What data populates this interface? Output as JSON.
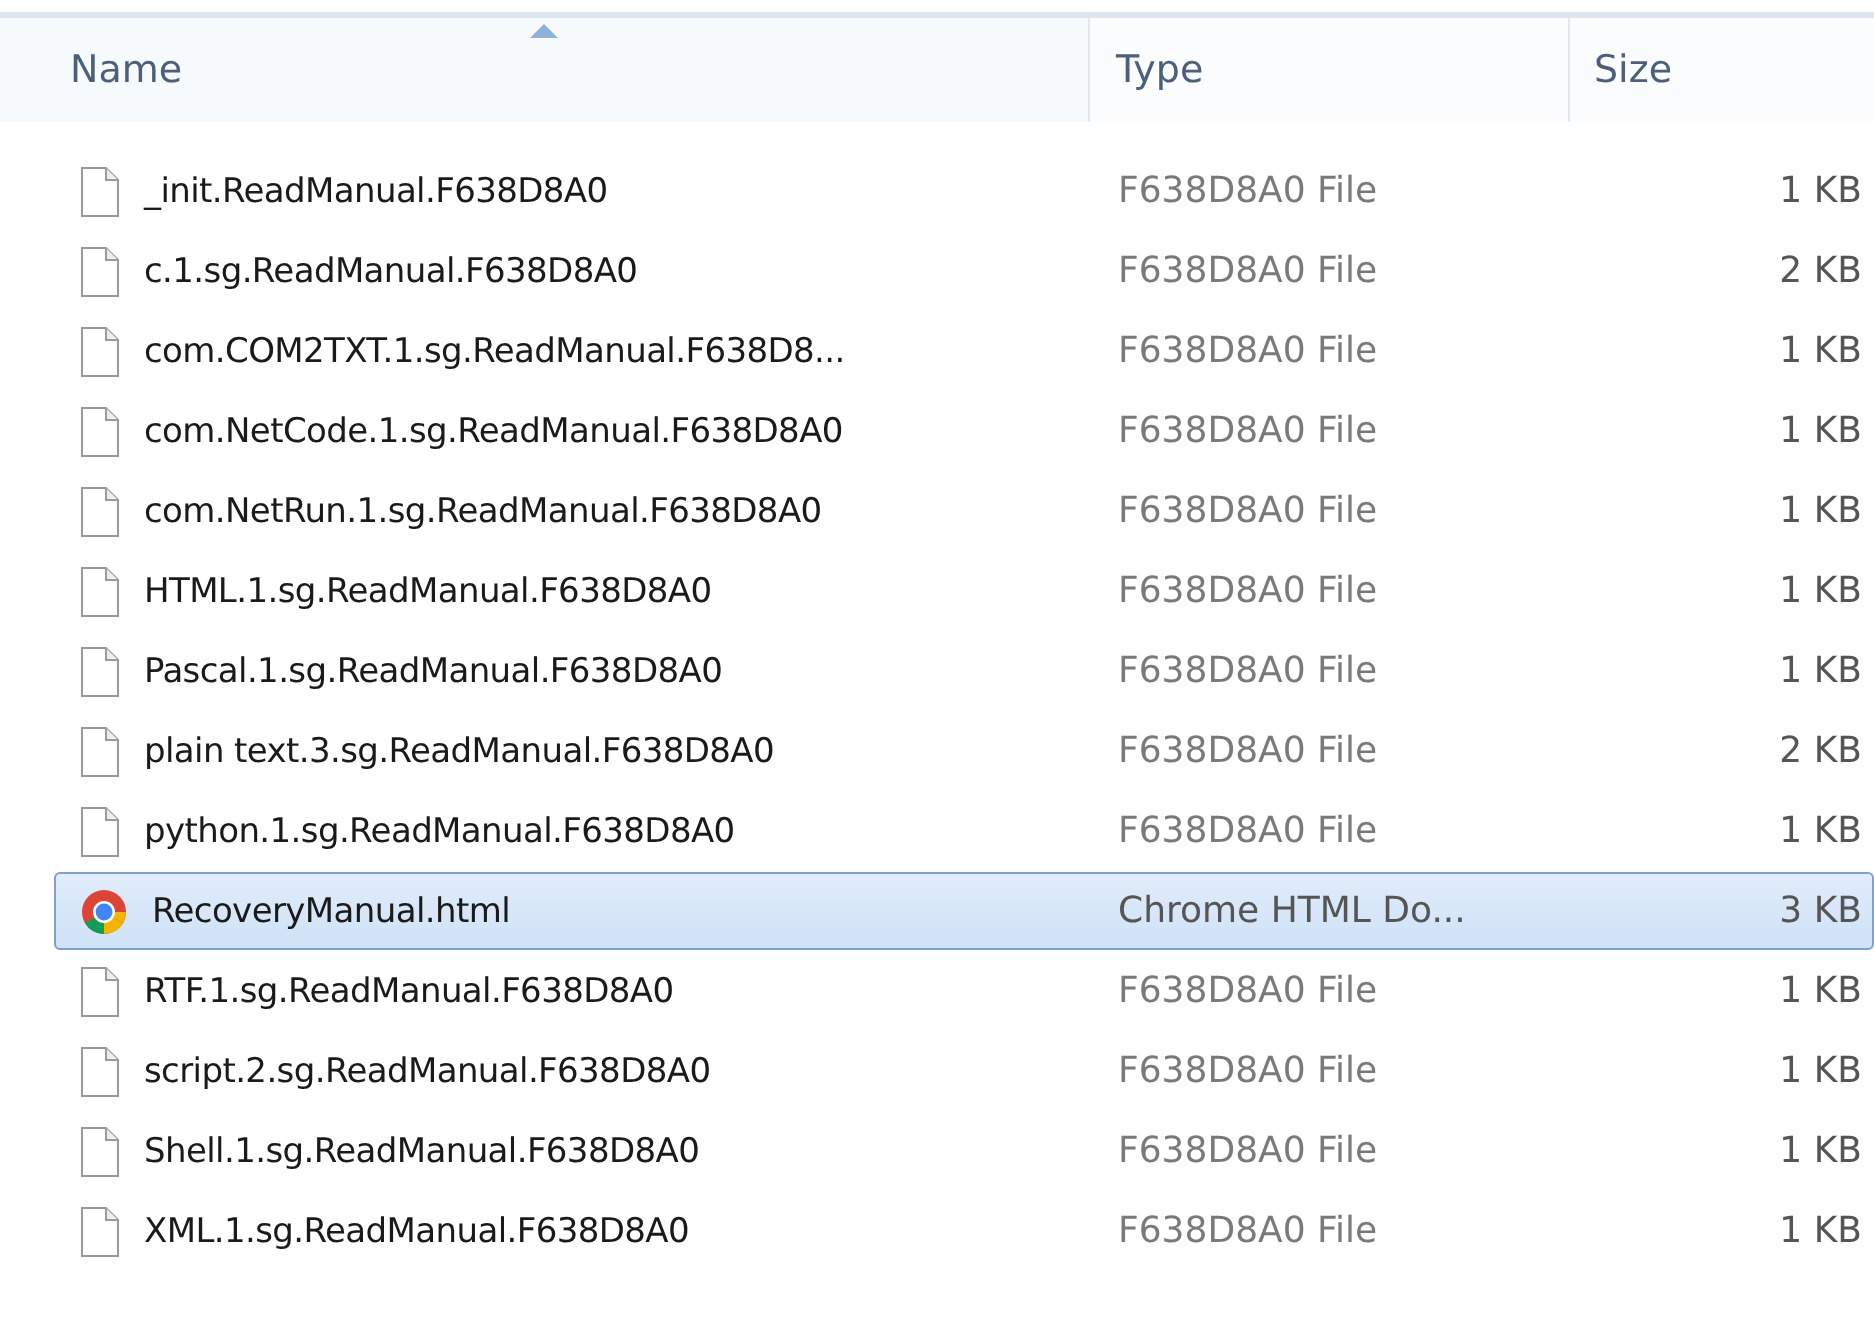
{
  "columns": [
    {
      "label": "Name",
      "sorted": true
    },
    {
      "label": "Type",
      "sorted": false
    },
    {
      "label": "Size",
      "sorted": false
    }
  ],
  "rows": [
    {
      "name": "_init.ReadManual.F638D8A0",
      "type": "F638D8A0 File",
      "size": "1 KB",
      "kind": "file",
      "selected": false
    },
    {
      "name": "c.1.sg.ReadManual.F638D8A0",
      "type": "F638D8A0 File",
      "size": "2 KB",
      "kind": "file",
      "selected": false
    },
    {
      "name": "com.COM2TXT.1.sg.ReadManual.F638D8...",
      "type": "F638D8A0 File",
      "size": "1 KB",
      "kind": "file",
      "selected": false
    },
    {
      "name": "com.NetCode.1.sg.ReadManual.F638D8A0",
      "type": "F638D8A0 File",
      "size": "1 KB",
      "kind": "file",
      "selected": false
    },
    {
      "name": "com.NetRun.1.sg.ReadManual.F638D8A0",
      "type": "F638D8A0 File",
      "size": "1 KB",
      "kind": "file",
      "selected": false
    },
    {
      "name": "HTML.1.sg.ReadManual.F638D8A0",
      "type": "F638D8A0 File",
      "size": "1 KB",
      "kind": "file",
      "selected": false
    },
    {
      "name": "Pascal.1.sg.ReadManual.F638D8A0",
      "type": "F638D8A0 File",
      "size": "1 KB",
      "kind": "file",
      "selected": false
    },
    {
      "name": "plain text.3.sg.ReadManual.F638D8A0",
      "type": "F638D8A0 File",
      "size": "2 KB",
      "kind": "file",
      "selected": false
    },
    {
      "name": "python.1.sg.ReadManual.F638D8A0",
      "type": "F638D8A0 File",
      "size": "1 KB",
      "kind": "file",
      "selected": false
    },
    {
      "name": "RecoveryManual.html",
      "type": "Chrome HTML Do...",
      "size": "3 KB",
      "kind": "browser",
      "selected": true
    },
    {
      "name": "RTF.1.sg.ReadManual.F638D8A0",
      "type": "F638D8A0 File",
      "size": "1 KB",
      "kind": "file",
      "selected": false
    },
    {
      "name": "script.2.sg.ReadManual.F638D8A0",
      "type": "F638D8A0 File",
      "size": "1 KB",
      "kind": "file",
      "selected": false
    },
    {
      "name": "Shell.1.sg.ReadManual.F638D8A0",
      "type": "F638D8A0 File",
      "size": "1 KB",
      "kind": "file",
      "selected": false
    },
    {
      "name": "XML.1.sg.ReadManual.F638D8A0",
      "type": "F638D8A0 File",
      "size": "1 KB",
      "kind": "file",
      "selected": false
    }
  ]
}
